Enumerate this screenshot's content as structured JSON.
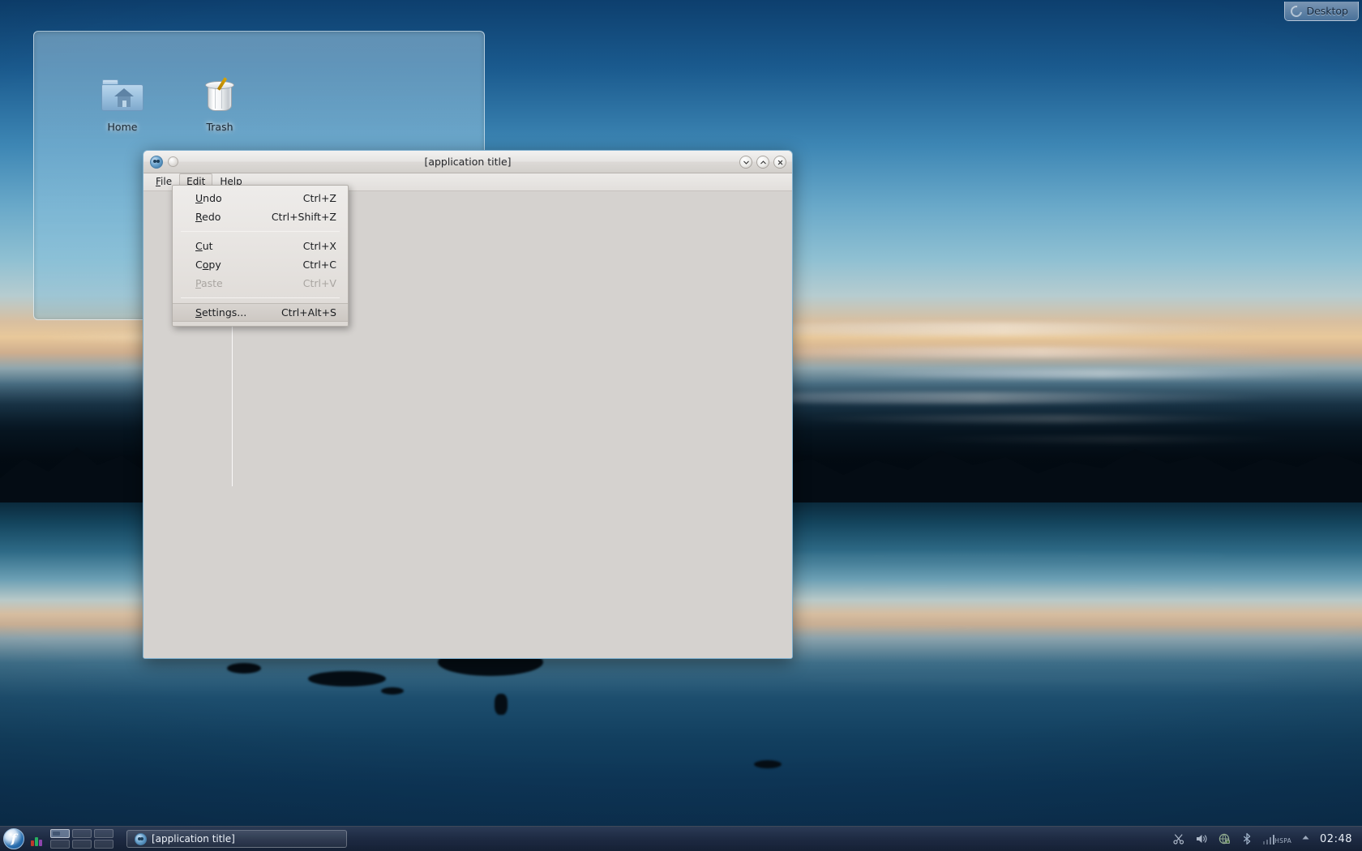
{
  "desktop": {
    "toolbox": {
      "label": "Desktop",
      "icon": "cashew-icon"
    },
    "folder_view": {
      "icons": [
        {
          "label": "Home",
          "icon": "home-folder-icon"
        },
        {
          "label": "Trash",
          "icon": "trash-icon"
        }
      ]
    }
  },
  "window": {
    "title": "[application title]",
    "icon": "application-icon",
    "pin_button": "pin-button",
    "controls": [
      {
        "name": "minimize",
        "glyph": "⌄"
      },
      {
        "name": "maximize",
        "glyph": "⌃"
      },
      {
        "name": "close",
        "glyph": "✕"
      }
    ],
    "menubar": [
      {
        "label": "File",
        "mnemonic": "F",
        "rest": "ile",
        "active": false
      },
      {
        "label": "Edit",
        "mnemonic": "E",
        "rest": "dit",
        "active": true
      },
      {
        "label": "Help",
        "mnemonic": "H",
        "rest": "elp",
        "active": false
      }
    ]
  },
  "edit_menu": {
    "items": [
      {
        "type": "item",
        "mnemonic": "U",
        "rest": "ndo",
        "label": "Undo",
        "accel": "Ctrl+Z",
        "disabled": false,
        "highlighted": false
      },
      {
        "type": "item",
        "mnemonic": "R",
        "rest": "edo",
        "label": "Redo",
        "accel": "Ctrl+Shift+Z",
        "disabled": false,
        "highlighted": false
      },
      {
        "type": "separator"
      },
      {
        "type": "item",
        "mnemonic": "C",
        "rest": "ut",
        "label": "Cut",
        "accel": "Ctrl+X",
        "disabled": false,
        "highlighted": false
      },
      {
        "type": "item",
        "mnemonic": "o",
        "rest": "py",
        "label": "Copy",
        "accel": "Ctrl+C",
        "disabled": false,
        "highlighted": false,
        "pre": "C"
      },
      {
        "type": "item",
        "mnemonic": "P",
        "rest": "aste",
        "label": "Paste",
        "accel": "Ctrl+V",
        "disabled": true,
        "highlighted": false
      },
      {
        "type": "separator"
      },
      {
        "type": "item",
        "mnemonic": "S",
        "rest": "ettings...",
        "label": "Settings...",
        "accel": "Ctrl+Alt+S",
        "disabled": false,
        "highlighted": true
      }
    ]
  },
  "taskbar": {
    "launcher": {
      "name": "kickoff-launcher",
      "glyph": "f"
    },
    "pager": {
      "rows": 2,
      "cols": 3,
      "current": 0
    },
    "task_buttons": [
      {
        "label": "[application title]",
        "icon": "application-icon",
        "active": true
      }
    ],
    "tray": [
      {
        "name": "klipper-icon"
      },
      {
        "name": "volume-icon"
      },
      {
        "name": "network-icon"
      },
      {
        "name": "bluetooth-icon"
      },
      {
        "name": "signal-icon",
        "label": "HSPA"
      },
      {
        "name": "show-hidden-icon"
      }
    ],
    "clock": "02:48"
  },
  "colors": {
    "window_bg": "#d5d2cf",
    "titlebar": "#e6e4e2",
    "menu_bg": "#e7e4e1",
    "taskbar": "#1e2a42",
    "accent": "#2a6fb0"
  }
}
